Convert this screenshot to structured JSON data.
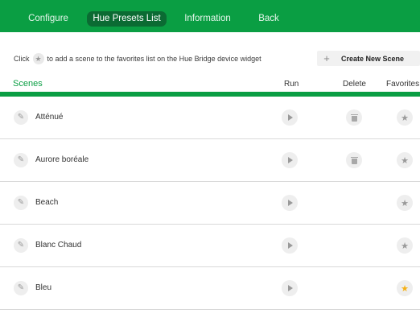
{
  "nav": {
    "tabs": [
      {
        "label": "Configure",
        "active": false
      },
      {
        "label": "Hue Presets List",
        "active": true
      },
      {
        "label": "Information",
        "active": false
      },
      {
        "label": "Back",
        "active": false
      }
    ]
  },
  "hint": {
    "before": "Click",
    "after": "to add a scene to the favorites list on the Hue Bridge device widget",
    "star_icon": "star-icon"
  },
  "create_button": {
    "icon": "plus-icon",
    "label": "Create New Scene"
  },
  "table": {
    "headers": {
      "scenes": "Scenes",
      "run": "Run",
      "delete": "Delete",
      "favorites": "Favorites"
    },
    "rows": [
      {
        "name": "Atténué",
        "deletable": true,
        "favorite": false
      },
      {
        "name": "Aurore boréale",
        "deletable": true,
        "favorite": false
      },
      {
        "name": "Beach",
        "deletable": false,
        "favorite": false
      },
      {
        "name": "Blanc Chaud",
        "deletable": false,
        "favorite": false
      },
      {
        "name": "Bleu",
        "deletable": false,
        "favorite": true
      }
    ]
  },
  "icons": {
    "edit": "pencil-icon",
    "run": "play-icon",
    "delete": "trash-icon",
    "favorite": "star-icon"
  },
  "colors": {
    "brand_green": "#0a9e43",
    "active_tab": "#0b6b33",
    "favorite_on": "#f5b014",
    "icon_gray": "#9a9a9a"
  }
}
